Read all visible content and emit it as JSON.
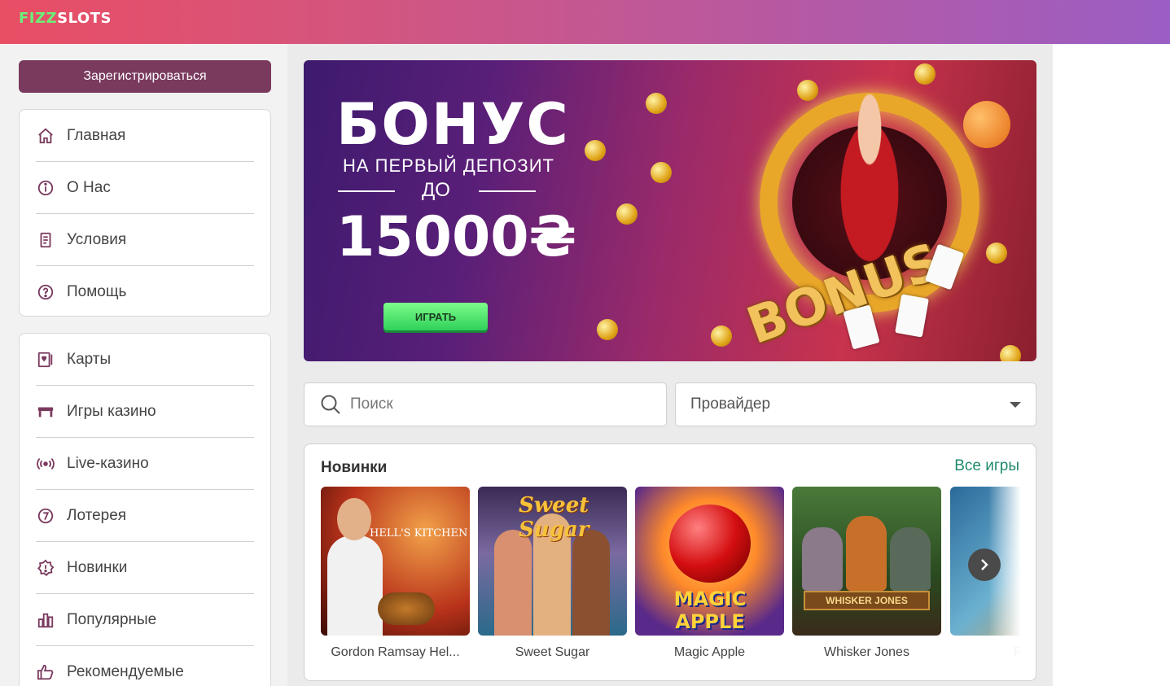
{
  "header": {
    "logo_part1": "FIZZ",
    "logo_part2": "SLOTS",
    "gradient_colors": [
      "#e94e64",
      "#9b5ec4"
    ]
  },
  "sidebar": {
    "register_label": "Зарегистрироваться",
    "menu_main": [
      {
        "icon": "home-icon",
        "label": "Главная"
      },
      {
        "icon": "info-icon",
        "label": "О Нас"
      },
      {
        "icon": "document-icon",
        "label": "Условия"
      },
      {
        "icon": "help-icon",
        "label": "Помощь"
      }
    ],
    "menu_games": [
      {
        "icon": "cards-icon",
        "label": "Карты"
      },
      {
        "icon": "casino-table-icon",
        "label": "Игры казино"
      },
      {
        "icon": "live-broadcast-icon",
        "label": "Live-казино"
      },
      {
        "icon": "lottery-icon",
        "label": "Лотерея"
      },
      {
        "icon": "new-icon",
        "label": "Новинки"
      },
      {
        "icon": "bar-chart-icon",
        "label": "Популярные"
      },
      {
        "icon": "thumbs-up-icon",
        "label": "Рекомендуемые"
      }
    ]
  },
  "banner": {
    "title": "БОНУС",
    "subtitle": "НА ПЕРВЫЙ ДЕПОЗИТ",
    "upto": "ДО",
    "amount": "15000₴",
    "play_label": "ИГРАТЬ",
    "art_text": "BONUS"
  },
  "filters": {
    "search_placeholder": "Поиск",
    "provider_label": "Провайдер"
  },
  "games": {
    "title": "Новинки",
    "all_games_label": "Все игры",
    "items": [
      {
        "name": "Gordon Ramsay Hel...",
        "thumb_text": "HELL'S KITCHEN"
      },
      {
        "name": "Sweet Sugar",
        "thumb_text": "Sweet Sugar"
      },
      {
        "name": "Magic Apple",
        "thumb_text": "MAGIC APPLE"
      },
      {
        "name": "Whisker Jones",
        "thumb_text": "WHISKER JONES"
      },
      {
        "name": "Fire"
      }
    ]
  },
  "colors": {
    "accent": "#7a3a5e",
    "link": "#1f8a6e"
  }
}
